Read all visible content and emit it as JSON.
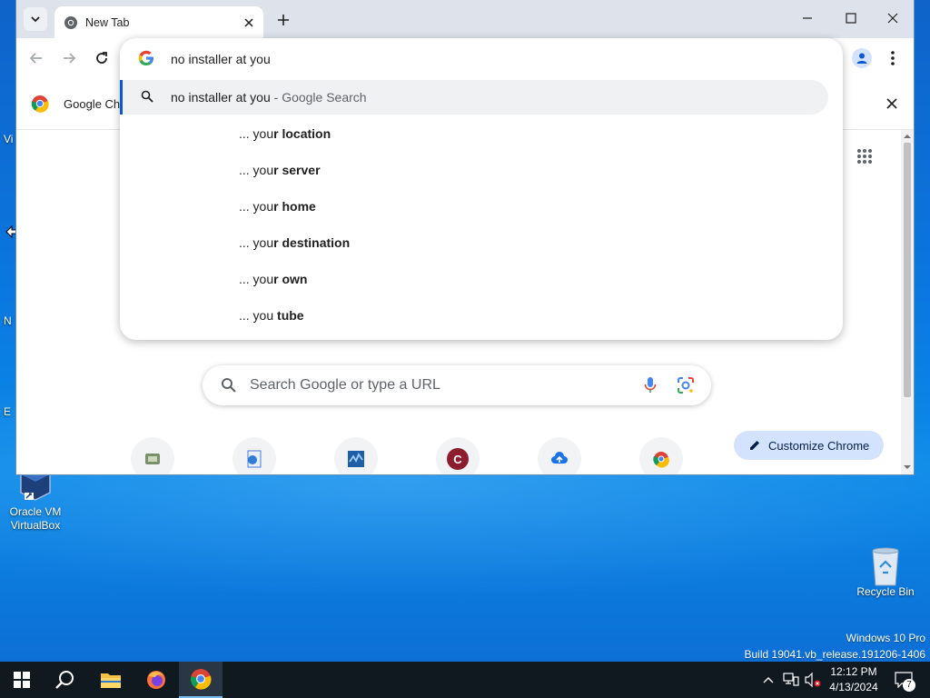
{
  "desktop": {
    "icons": [
      {
        "label_line1": "Oracle VM",
        "label_line2": "VirtualBox"
      },
      {
        "label_line1": "Recycle Bin",
        "label_line2": ""
      }
    ],
    "edge_letters": [
      "Vi",
      "N",
      "E"
    ]
  },
  "browser": {
    "tab": {
      "title": "New Tab"
    },
    "omnibox": {
      "input_text": "no installer at you",
      "top_suggestion": {
        "query": "no installer at you",
        "separator": " - ",
        "suffix": "Google Search"
      },
      "suggestions": [
        {
          "prefix": "... you",
          "bold": "r location"
        },
        {
          "prefix": "... you",
          "bold": "r server"
        },
        {
          "prefix": "... you",
          "bold": "r home"
        },
        {
          "prefix": "... you",
          "bold": "r destination"
        },
        {
          "prefix": "... you",
          "bold": "r own"
        },
        {
          "prefix": "... you ",
          "bold": "tube"
        }
      ]
    },
    "infobar": {
      "text": "Google Ch"
    },
    "ntp": {
      "search_placeholder": "Search Google or type a URL",
      "customize_label": "Customize Chrome",
      "shortcut_letter": "C"
    }
  },
  "watermark": {
    "line1": "Windows 10 Pro",
    "line2": "Build 19041.vb_release.191206-1406"
  },
  "taskbar": {
    "time": "12:12 PM",
    "date": "4/13/2024",
    "notification_count": "7"
  },
  "colors": {
    "accent": "#0b57d0",
    "customize_bg": "#d3e3fd",
    "taskbar": "#101820"
  }
}
